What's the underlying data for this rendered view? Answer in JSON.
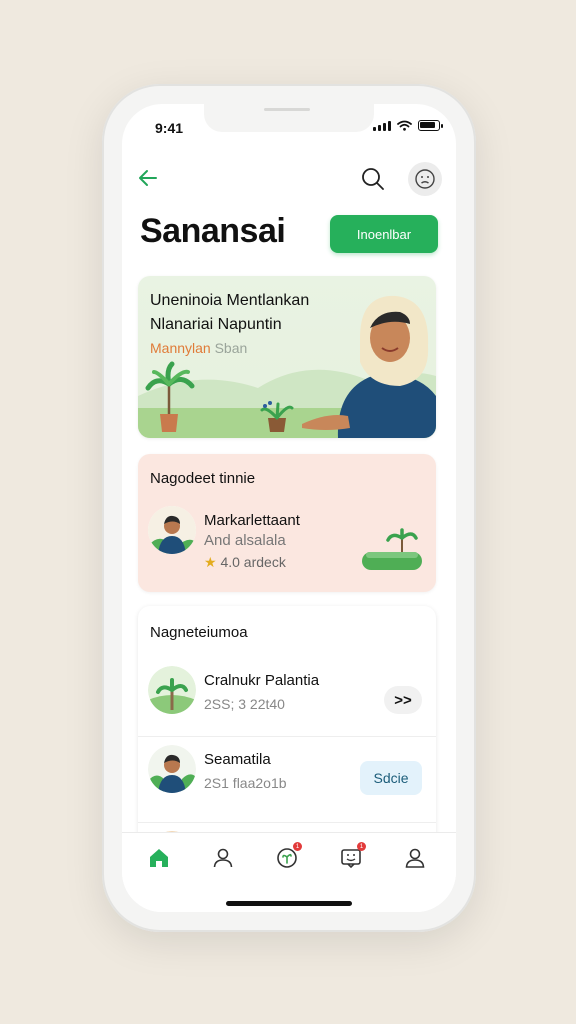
{
  "status_bar": {
    "time": "9:41"
  },
  "header": {
    "title": "Sanansai",
    "cta_label": "Inoenlbar"
  },
  "hero": {
    "line1": "Uneninoia Mentlankan",
    "line2": "Nlanariai Napuntin",
    "sub_accent": "Mannylan",
    "sub_rest": " Sban"
  },
  "recommend": {
    "title": "Nagodeet tinnie",
    "name": "Markarlettaant",
    "subtitle": "And alsalala",
    "rating": "4.0",
    "rating_suffix": " ardeck"
  },
  "list": {
    "title": "Nagneteiumoa",
    "items": [
      {
        "name": "Cralnukr Palantia",
        "sub": "2SS; 3 22t40",
        "action": ">>"
      },
      {
        "name": "Seamatila",
        "sub": "2S1 flaa2o1b",
        "action": "Sdcie"
      }
    ]
  },
  "colors": {
    "accent": "#26b05b",
    "hero_bg": "#e9f3e3",
    "recommend_bg": "#fbe7e0",
    "badge": "#e23b3b"
  },
  "tabbar": {
    "tabs": [
      {
        "icon": "home-icon",
        "active": true
      },
      {
        "icon": "profile-icon",
        "active": false
      },
      {
        "icon": "plant-chat-icon",
        "badge": "1"
      },
      {
        "icon": "messages-icon",
        "badge": "1"
      },
      {
        "icon": "account-icon",
        "active": false
      }
    ]
  }
}
